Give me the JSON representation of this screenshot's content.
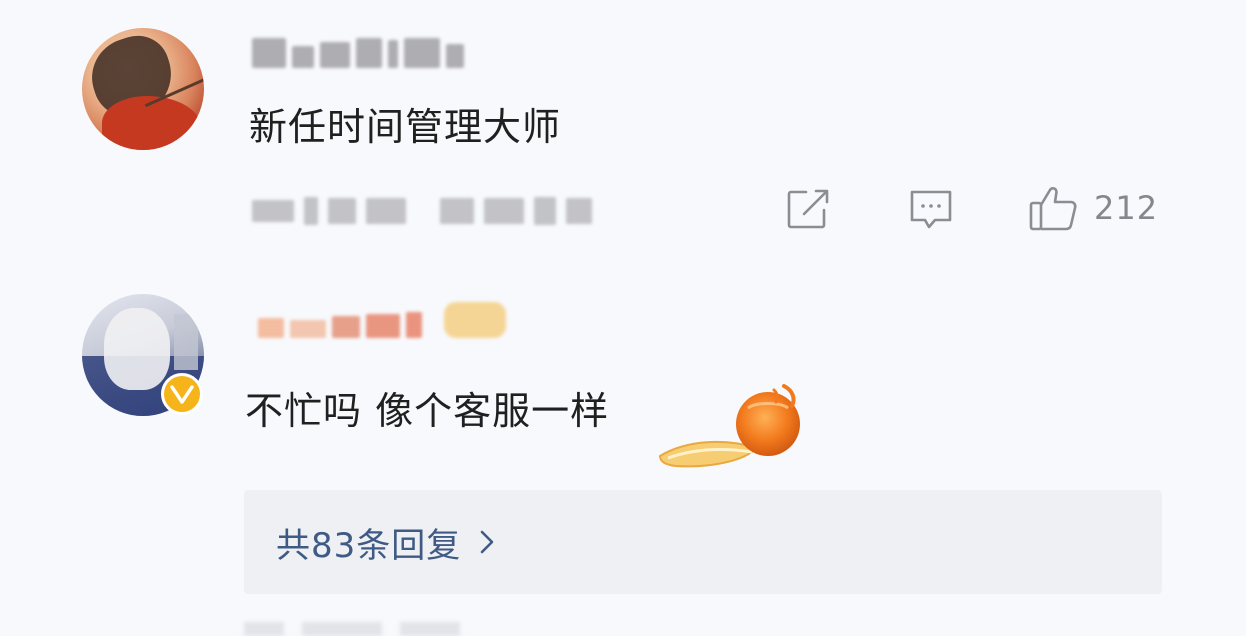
{
  "comments": [
    {
      "text": "新任时间管理大师",
      "likes": "212",
      "actions": {
        "share_icon": "share-icon",
        "reply_icon": "comment-icon",
        "like_icon": "thumbs-up-icon"
      }
    },
    {
      "text": "不忙吗 像个客服一样",
      "verified": true,
      "badge_color": "#f5b51a"
    }
  ],
  "replies": {
    "label": "共83条回复",
    "chevron_icon": "chevron-right-icon"
  },
  "colors": {
    "background": "#f8f9fc",
    "text": "#202020",
    "muted": "#86868c",
    "link": "#3f5a84",
    "reply_box": "#eef0f4"
  }
}
